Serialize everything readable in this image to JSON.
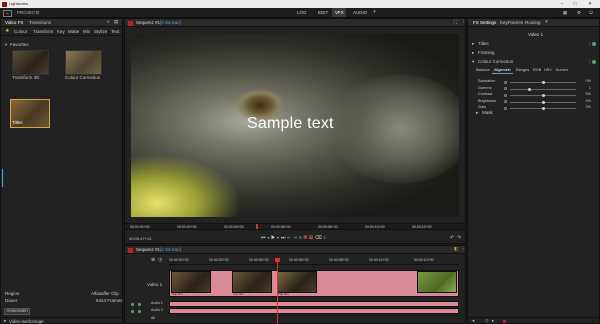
{
  "app": {
    "title": "Lightworks"
  },
  "menubar": {
    "project_label": "PROJECT",
    "project_num": "2",
    "tabs": [
      "LOG",
      "EDIT",
      "VFX",
      "AUDIO"
    ],
    "active_tab": "VFX",
    "add": "+",
    "accent": "#c01f1f"
  },
  "left": {
    "tabs": [
      "Video FX",
      "Transitions"
    ],
    "categories": [
      "Colour",
      "Transform",
      "Key",
      "Matte",
      "Mix",
      "Stylize",
      "Text"
    ],
    "section": "Favorites",
    "fx": [
      {
        "label": "Transform 3D"
      },
      {
        "label": "Colour Correction"
      },
      {
        "label": "Titles"
      }
    ],
    "region_label": "Region",
    "region_value": "Alfasaffer Clip",
    "duration_label": "Dauer",
    "duration_value": "6444 Frames",
    "advanced_label": "Anwenden",
    "footer": "Video-werkzeuge"
  },
  "viewer": {
    "title": "Sequenz #1",
    "tag": "[2 Sa-ban]",
    "overlay_text": "Sample text",
    "ruler": [
      "00:00:00+00",
      "00:00:02+00",
      "00:00:04+00",
      "00:00:06+00",
      "00:00:08+00",
      "00:00:10+00",
      "00:00:12+00"
    ],
    "timecode": "00:00:47+13"
  },
  "right": {
    "tabs": [
      "FX Settings",
      "KeyFrames",
      "Routing"
    ],
    "add": "+",
    "header": "Video 1",
    "groups": [
      "Titles",
      "Framing",
      "Colour Correction"
    ],
    "subtabs": [
      "Balance",
      "Allgemein",
      "Ranges",
      "RGB",
      "HSV",
      "Kurven"
    ],
    "active_subtab": "Allgemein",
    "params": [
      {
        "name": "Saturation",
        "value": "0%",
        "pos": 0.5
      },
      {
        "name": "Gamma",
        "value": "1",
        "pos": 0.3
      },
      {
        "name": "Contrast",
        "value": "0%",
        "pos": 0.5
      },
      {
        "name": "Brightness",
        "value": "0%",
        "pos": 0.5
      },
      {
        "name": "Gain",
        "value": "0%",
        "pos": 0.5
      }
    ],
    "mask": "Mask"
  },
  "timeline": {
    "title": "Sequenz #1",
    "tag": "[2 Sa-ban]",
    "ruler": [
      "00:00:00+00",
      "00:00:02+00",
      "00:00:04+00",
      "00:00:06+00",
      "00:00:08+00",
      "00:00:10+00",
      "00:00:12+00"
    ],
    "track_video": "Video 1",
    "track_a1": "Audio 1",
    "track_a2": "Audio 2",
    "track_all": "All",
    "clip_label": "Clip Nr1"
  }
}
